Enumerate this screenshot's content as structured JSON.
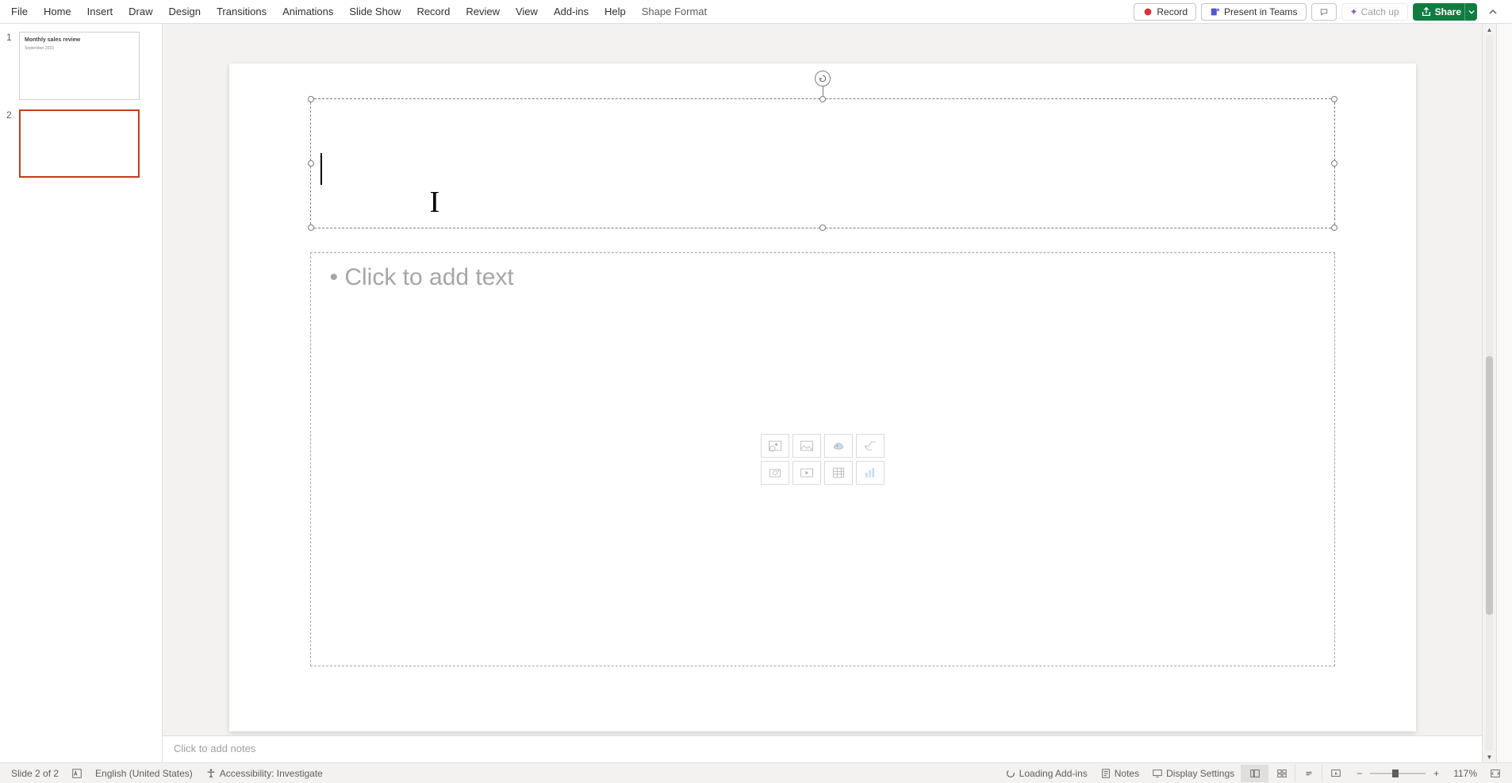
{
  "menu": {
    "items": [
      "File",
      "Home",
      "Insert",
      "Draw",
      "Design",
      "Transitions",
      "Animations",
      "Slide Show",
      "Record",
      "Review",
      "View",
      "Add-ins",
      "Help",
      "Shape Format"
    ]
  },
  "topbar": {
    "record": "Record",
    "present_teams": "Present in Teams",
    "catch_up": "Catch up",
    "share": "Share"
  },
  "thumbnails": {
    "slides": [
      {
        "num": "1",
        "title": "Monthly sales review",
        "sub": "September 2023",
        "selected": false
      },
      {
        "num": "2",
        "title": "",
        "sub": "",
        "selected": true
      }
    ]
  },
  "slide": {
    "content_placeholder": "Click to add text"
  },
  "notes": {
    "placeholder": "Click to add notes"
  },
  "status": {
    "slide_counter": "Slide 2 of 2",
    "language": "English (United States)",
    "accessibility": "Accessibility: Investigate",
    "loading_addins": "Loading Add-ins",
    "notes": "Notes",
    "display_settings": "Display Settings",
    "zoom": "117%"
  }
}
